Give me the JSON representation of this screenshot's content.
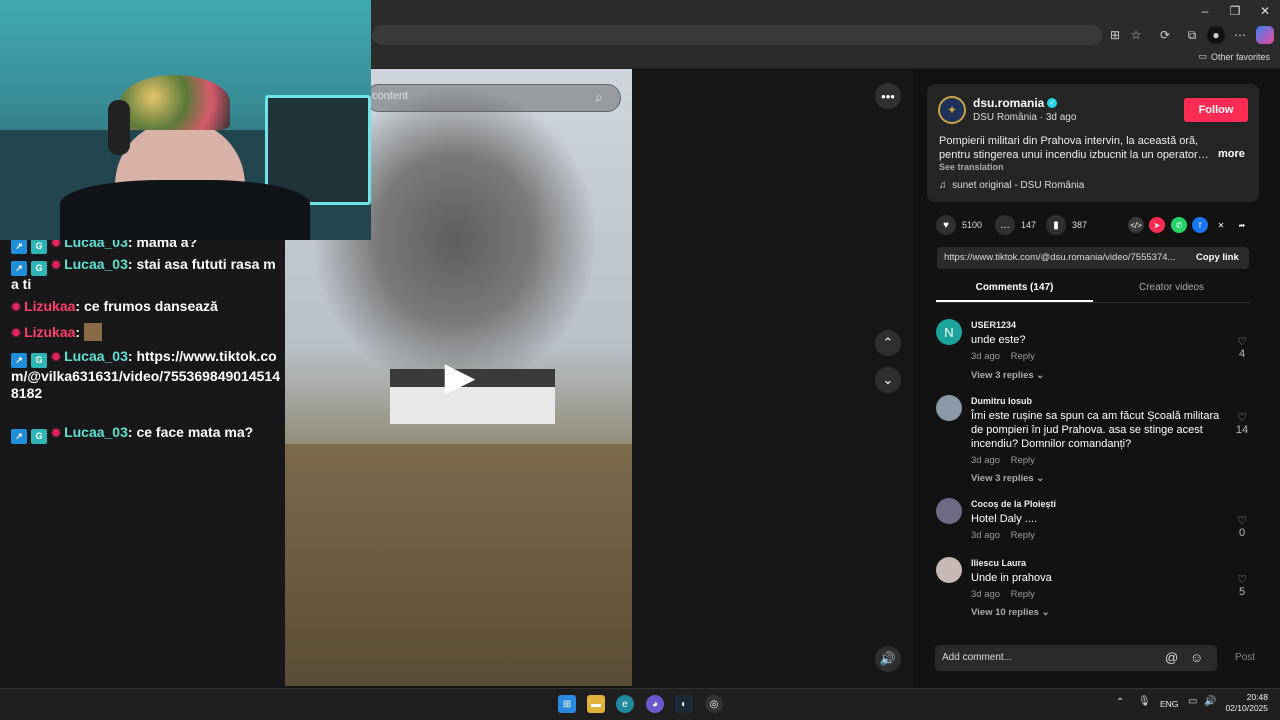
{
  "browser": {
    "other_favorites": "Other favorites"
  },
  "chat": {
    "messages": [
      {
        "user": "Lucaa_03",
        "text": "mama a?"
      },
      {
        "user": "Lucaa_03",
        "text": "stai asa fututi rasa ma ti"
      },
      {
        "user": "Lizukaa",
        "text": "ce frumos dansează"
      },
      {
        "user": "Lizukaa",
        "text": ""
      },
      {
        "user": "Lucaa_03",
        "text": "https://www.tiktok.com/@vilka631631/video/7553698490145148182"
      },
      {
        "user": "Lucaa_03",
        "text": "ce face mata ma?"
      }
    ]
  },
  "video": {
    "search_placeholder": "content",
    "play_icon": "play-icon"
  },
  "post": {
    "username": "dsu.romania",
    "display_name": "DSU România",
    "time": "3d ago",
    "follow_label": "Follow",
    "caption": "Pompierii militari din Prahova intervin, la această oră, pentru stingerea unui incendiu izbucnit la un operator…",
    "more_label": "more",
    "see_translation": "See translation",
    "sound": "sunet original - DSU România",
    "likes": "5100",
    "comments": "147",
    "saves": "387",
    "link": "https://www.tiktok.com/@dsu.romania/video/7555374...",
    "copy_link": "Copy link"
  },
  "tabs": {
    "comments": "Comments (147)",
    "creator": "Creator videos"
  },
  "comments": [
    {
      "user": "USER1234",
      "text": "unde este?",
      "time": "3d ago",
      "reply": "Reply",
      "replies": "View 3 replies",
      "likes": "4",
      "avatar_color": "#1ba39c",
      "initial": "N"
    },
    {
      "user": "Dumitru Iosub",
      "text": "Îmi este rușine sa spun ca am făcut Școală militara de pompieri în jud Prahova. asa se stinge acest incendiu? Domnilor comandanți?",
      "time": "3d ago",
      "reply": "Reply",
      "replies": "View 3 replies",
      "likes": "14",
      "avatar_color": "#8a9aa8",
      "initial": ""
    },
    {
      "user": "Cocoș de la Ploiești",
      "text": "Hotel Daly ....",
      "time": "3d ago",
      "reply": "Reply",
      "replies": "",
      "likes": "0",
      "avatar_color": "#6f6a86",
      "initial": ""
    },
    {
      "user": "Iliescu Laura",
      "text": "Unde in prahova",
      "time": "3d ago",
      "reply": "Reply",
      "replies": "View 10 replies",
      "likes": "5",
      "avatar_color": "#c9b9b4",
      "initial": ""
    }
  ],
  "comment_box": {
    "placeholder": "Add comment...",
    "post_label": "Post"
  },
  "taskbar": {
    "lang": "ENG",
    "time": "20:48",
    "date": "02/10/2025"
  }
}
